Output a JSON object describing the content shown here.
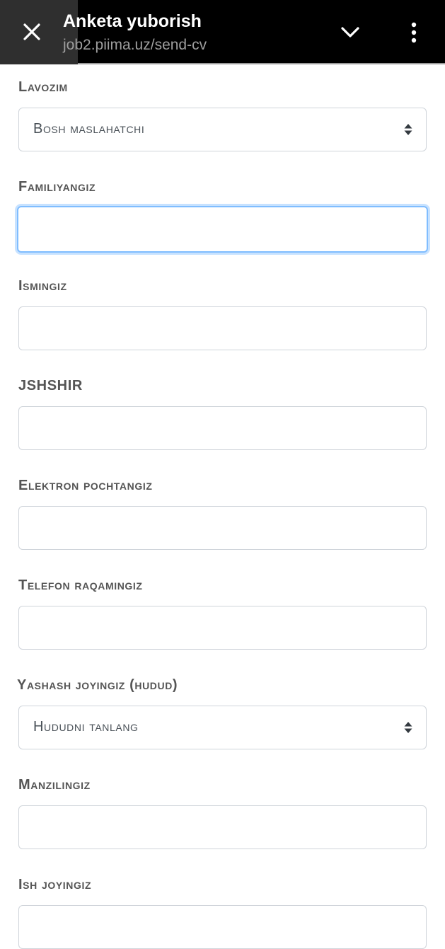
{
  "header": {
    "title": "Anketa yuborish",
    "url": "job2.piima.uz/send-cv"
  },
  "form": {
    "lavozim_label": "Lavozim",
    "lavozim_value": "Bosh maslahatchi",
    "familiya_label": "Familiyangiz",
    "ism_label": "Ismingiz",
    "jshshir_label": "JSHSHIR",
    "email_label": "Elektron pochtangiz",
    "telefon_label": "Telefon raqamingiz",
    "hudud_label": "Yashash joyingiz (hudud)",
    "hudud_value": "Hududni tanlang",
    "manzil_label": "Manzilingiz",
    "ish_label": "Ish joyingiz"
  },
  "colors": {
    "topbar_bg": "#000000",
    "focus_border": "#80bdff",
    "label_text": "#555555"
  },
  "icons": [
    "close-icon",
    "chevron-down-icon",
    "more-vertical-icon",
    "select-arrows-icon"
  ]
}
